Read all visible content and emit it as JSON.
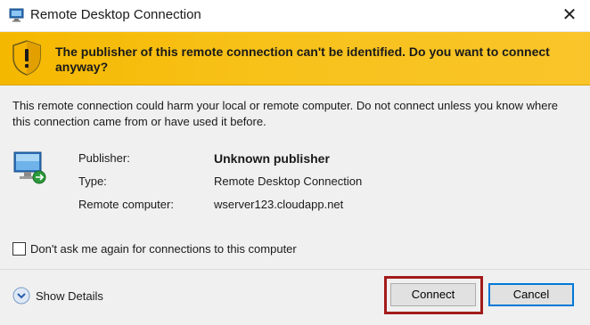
{
  "window": {
    "title": "Remote Desktop Connection",
    "close_glyph": "✕"
  },
  "banner": {
    "message": "The publisher of this remote connection can't be identified. Do you want to connect anyway?",
    "icon": "warning-shield-icon",
    "color": "#f7be12"
  },
  "warning_text": "This remote connection could harm your local or remote computer. Do not connect unless you know where this connection came from or have used it before.",
  "details": {
    "icon": "remote-computer-icon",
    "rows": [
      {
        "label": "Publisher:",
        "value": "Unknown publisher"
      },
      {
        "label": "Type:",
        "value": "Remote Desktop Connection"
      },
      {
        "label": "Remote computer:",
        "value": "wserver123.cloudapp.net"
      }
    ]
  },
  "checkbox": {
    "label": "Don't ask me again for connections to this computer",
    "checked": false
  },
  "footer": {
    "show_details_label": "Show Details",
    "connect_label": "Connect",
    "cancel_label": "Cancel",
    "highlight_color": "#a31b1b"
  }
}
